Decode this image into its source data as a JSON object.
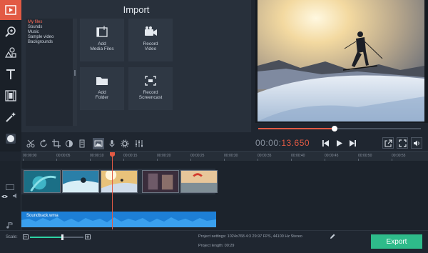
{
  "colors": {
    "accent": "#e25a44",
    "export": "#2ebb8a",
    "audio": "#1d7fd6",
    "background": "#1f2630"
  },
  "toolbar": {
    "tools": [
      {
        "icon": "import-media-icon",
        "active": true
      },
      {
        "icon": "zoom-in-icon",
        "active": false
      },
      {
        "icon": "titles-shapes-icon",
        "active": false
      },
      {
        "icon": "text-icon",
        "active": false
      },
      {
        "icon": "filmstrip-icon",
        "active": false
      },
      {
        "icon": "magic-wand-icon",
        "active": false
      },
      {
        "icon": "record-icon",
        "active": false
      }
    ]
  },
  "import": {
    "title": "Import",
    "file_tree": [
      "My files",
      "Sounds",
      "Music",
      "Sample video",
      "Backgrounds"
    ],
    "buttons": {
      "add_media": "Add\nMedia Files",
      "record_video": "Record\nVideo",
      "add_folder": "Add\nFolder",
      "record_screencast": "Record\nScreencast"
    }
  },
  "player": {
    "timecode_prefix": "00:00:",
    "timecode_current": "13.650",
    "progress": 0.47
  },
  "timeline": {
    "ticks": [
      "00:00:00",
      "00:00:05",
      "00:00:10",
      "00:00:15",
      "00:00:20",
      "00:00:25",
      "00:00:30",
      "00:00:35",
      "00:00:40",
      "00:00:45",
      "00:00:50",
      "00:00:55"
    ],
    "audio_label": "Soundtrack.wma"
  },
  "footer": {
    "scale_label": "Scale:",
    "scale_value": 0.58,
    "project_settings": "Project settings:  1024x768 4:3 29.97 FPS, 44100 Hz Stereo",
    "project_length": "Project length:     00:29",
    "export_label": "Export"
  }
}
